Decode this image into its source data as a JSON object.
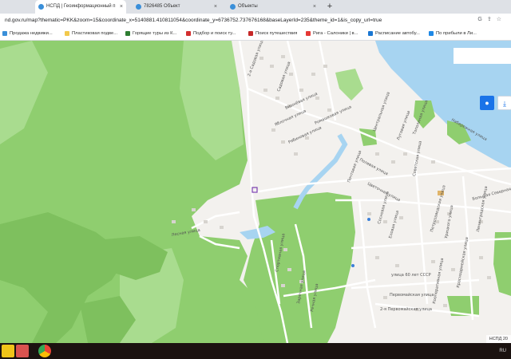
{
  "tabs": [
    {
      "title": "НСПД | Геоинформационный п",
      "active": true
    },
    {
      "title": "7826485 Объект",
      "active": false
    },
    {
      "title": "Объекты",
      "active": false
    }
  ],
  "new_tab_symbol": "+",
  "close_symbol": "×",
  "address_bar": {
    "url": "nd.gov.ru/map?thematic=PKK&zoom=15&coordinate_x=5140881.410811054&coordinate_y=6736752.737676168&baseLayerId=235&theme_id=1&is_copy_url=true"
  },
  "bookmarks": [
    {
      "label": "Продажа недвижи...",
      "icon_color": "#3a8fd9"
    },
    {
      "label": "Пластиковая подве...",
      "icon_color": "#f2c94c"
    },
    {
      "label": "Горящие туры из К...",
      "icon_color": "#2e7d32"
    },
    {
      "label": "Подбор и поиск ту...",
      "icon_color": "#d32f2f"
    },
    {
      "label": "Поиск путешествия",
      "icon_color": "#c62828"
    },
    {
      "label": "Рига - Салоники | в...",
      "icon_color": "#e53935"
    },
    {
      "label": "Расписание автобу...",
      "icon_color": "#1976d2"
    },
    {
      "label": "По прибыли в Ли...",
      "icon_color": "#1e88e5"
    }
  ],
  "streets": [
    "2-я Садовая улица",
    "Садовая улица",
    "Вишнёвая улица",
    "Яблочная улица",
    "Рябиновая улица",
    "Ромашковая улица",
    "Центральная улица",
    "Луговая улица",
    "Тополиная улица",
    "Набережная улица",
    "Полевая улица",
    "Цветочная улица",
    "Почтовая улица",
    "Сосновая улица",
    "Еловая улица",
    "Петрозаводская улица",
    "улица 60 лет СССР",
    "Первомайская улица",
    "2-я Первомайская улица",
    "Советская улица",
    "Большая Северная улица",
    "Урицкого улица",
    "Ленинградская улица",
    "Кооперативная улица",
    "Красноармейская улица",
    "Лесная улица",
    "Спортивная улица",
    "Заречная улица",
    "Речная улица"
  ],
  "map_controls": {
    "locate_icon": "target-icon",
    "download_icon": "download-icon"
  },
  "map_footer": "НСПД 20",
  "colors": {
    "forest": "#8fce6f",
    "forest_light": "#a9dc8f",
    "forest_dark": "#7ec05e",
    "water": "#a7d4f1",
    "settlement": "#f3f1ee",
    "accent": "#1a73e8"
  },
  "taskbar": {
    "tray_language": "RU"
  }
}
